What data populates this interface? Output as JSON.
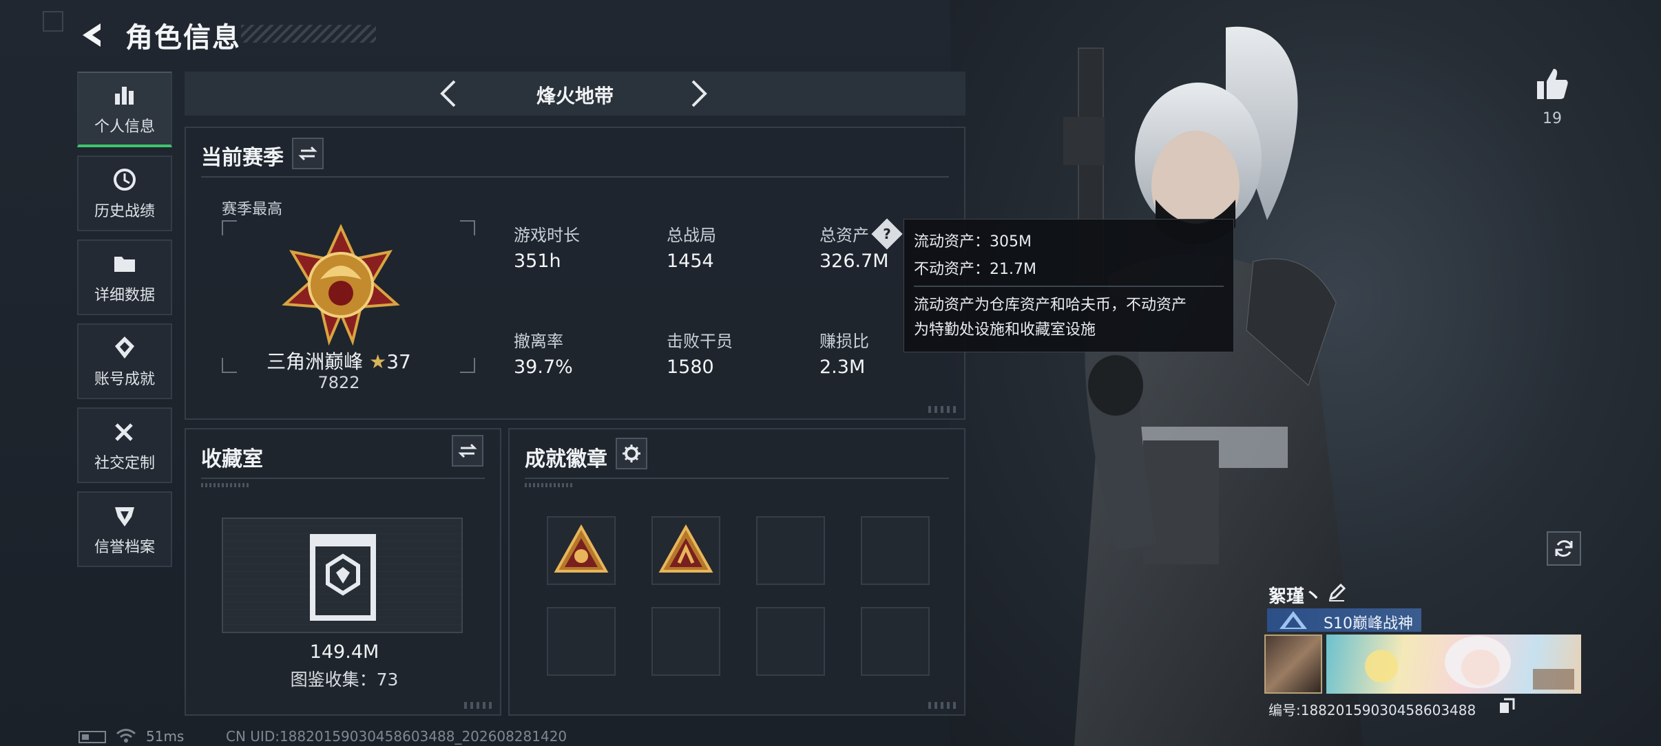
{
  "header": {
    "title": "角色信息"
  },
  "sidebar": {
    "items": [
      {
        "label": "个人信息",
        "icon": "bar-chart-icon",
        "active": true
      },
      {
        "label": "历史战绩",
        "icon": "history-clock-icon",
        "active": false
      },
      {
        "label": "详细数据",
        "icon": "folder-icon",
        "active": false
      },
      {
        "label": "账号成就",
        "icon": "achievement-icon",
        "active": false
      },
      {
        "label": "社交定制",
        "icon": "tools-icon",
        "active": false
      },
      {
        "label": "信誉档案",
        "icon": "reputation-icon",
        "active": false
      }
    ]
  },
  "mode": {
    "name": "烽火地带"
  },
  "season": {
    "title": "当前赛季",
    "best_label": "赛季最高",
    "rank_name": "三角洲巅峰",
    "rank_stars": "37",
    "rank_points": "7822",
    "stats": [
      {
        "label": "游戏时长",
        "value": "351h"
      },
      {
        "label": "总战局",
        "value": "1454"
      },
      {
        "label": "总资产",
        "value": "326.7M"
      },
      {
        "label": "撤离率",
        "value": "39.7%"
      },
      {
        "label": "击败干员",
        "value": "1580"
      },
      {
        "label": "赚损比",
        "value": "2.3M"
      }
    ]
  },
  "tooltip": {
    "liquid": "流动资产：305M",
    "fixed": "不动资产：21.7M",
    "desc_line1": "流动资产为仓库资产和哈夫币，不动资产",
    "desc_line2": "为特勤处设施和收藏室设施"
  },
  "collection": {
    "title": "收藏室",
    "value": "149.4M",
    "count_text": "图鉴收集：73"
  },
  "badges": {
    "title": "成就徽章",
    "slots": [
      {
        "filled": true
      },
      {
        "filled": true
      },
      {
        "filled": false
      },
      {
        "filled": false
      },
      {
        "filled": false
      },
      {
        "filled": false
      },
      {
        "filled": false
      },
      {
        "filled": false
      }
    ]
  },
  "character": {
    "likes": "19",
    "nickname": "絮瑾丶",
    "title_badge": "S10巅峰战神",
    "id_text": "编号:18820159030458603488"
  },
  "status": {
    "ping": "51ms",
    "uid": "CN UID:18820159030458603488_202608281420"
  },
  "colors": {
    "accent": "#3ec46d",
    "badge_gold": "#d19a3a"
  }
}
